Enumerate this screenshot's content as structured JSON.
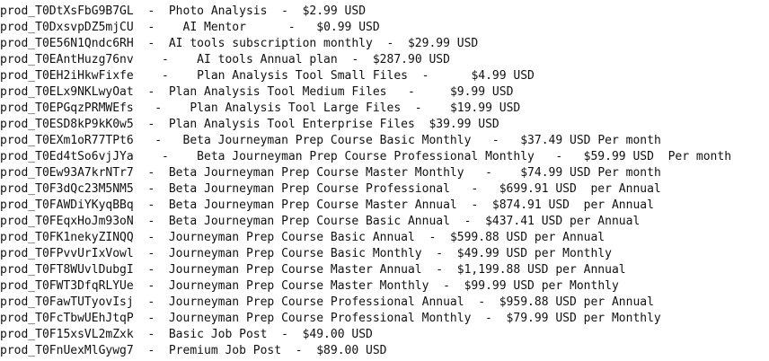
{
  "products": [
    {
      "id": "prod_T0DtXsFbG9B7GL",
      "sep1": "  -  ",
      "name": "Photo Analysis",
      "sep2": "  -  ",
      "price": "$2.99 USD",
      "period": ""
    },
    {
      "id": "prod_T0DxsvpDZ5mjCU",
      "sep1": "  -    ",
      "name": "AI Mentor",
      "sep2": "      -   ",
      "price": "$0.99 USD",
      "period": ""
    },
    {
      "id": "prod_T0E56N1Qndc6RH",
      "sep1": "  -  ",
      "name": "AI tools subscription monthly",
      "sep2": "  -  ",
      "price": "$29.99 USD",
      "period": ""
    },
    {
      "id": "prod_T0EAntHuzg76nv",
      "sep1": "    -    ",
      "name": "AI tools Annual plan",
      "sep2": "  -  ",
      "price": "$287.90 USD",
      "period": ""
    },
    {
      "id": "prod_T0EH2iHkwFixfe",
      "sep1": "    -    ",
      "name": "Plan Analysis Tool Small Files",
      "sep2": "  -      ",
      "price": "$4.99 USD",
      "period": ""
    },
    {
      "id": "prod_T0ELx9NKLwyOat",
      "sep1": "  -  ",
      "name": "Plan Analysis Tool Medium Files",
      "sep2": "   -     ",
      "price": "$9.99 USD",
      "period": ""
    },
    {
      "id": "prod_T0EPGqzPRMWEfs",
      "sep1": "   -    ",
      "name": "Plan Analysis Tool Large Files",
      "sep2": "  -    ",
      "price": "$19.99 USD",
      "period": ""
    },
    {
      "id": "prod_T0ESD8kP9kK0w5",
      "sep1": "  -  ",
      "name": "Plan Analysis Tool Enterprise Files",
      "sep2": "  ",
      "price": "$39.99 USD",
      "period": ""
    },
    {
      "id": "prod_T0EXm1oR77TPt6",
      "sep1": "   -   ",
      "name": "Beta Journeyman Prep Course Basic Monthly",
      "sep2": "   -   ",
      "price": "$37.49 USD",
      "period": " Per month"
    },
    {
      "id": "prod_T0Ed4tSo6vjJYa",
      "sep1": "    -    ",
      "name": "Beta Journeyman Prep Course Professional Monthly",
      "sep2": "   -   ",
      "price": "$59.99 USD",
      "period": "  Per month"
    },
    {
      "id": "prod_T0Ew93A7krNTr7",
      "sep1": "  -  ",
      "name": "Beta Journeyman Prep Course Master Monthly",
      "sep2": "   -    ",
      "price": "$74.99 USD",
      "period": " Per month"
    },
    {
      "id": "prod_T0F3dQc23M5NM5",
      "sep1": "  -  ",
      "name": "Beta Journeyman Prep Course Professional",
      "sep2": "   -   ",
      "price": "$699.91 USD",
      "period": "  per Annual"
    },
    {
      "id": "prod_T0FAWDiYKyqBBq",
      "sep1": "  -  ",
      "name": "Beta Journeyman Prep Course Master Annual",
      "sep2": "  -  ",
      "price": "$874.91 USD",
      "period": "  per Annual"
    },
    {
      "id": "prod_T0FEqxHoJm93oN",
      "sep1": "  -  ",
      "name": "Beta Journeyman Prep Course Basic Annual",
      "sep2": "  -  ",
      "price": "$437.41 USD",
      "period": " per Annual"
    },
    {
      "id": "prod_T0FK1nekyZINQQ",
      "sep1": "  -  ",
      "name": "Journeyman Prep Course Basic Annual",
      "sep2": "  -  ",
      "price": "$599.88 USD",
      "period": " per Annual"
    },
    {
      "id": "prod_T0FPvvUrIxVowl",
      "sep1": "  -  ",
      "name": "Journeyman Prep Course Basic Monthly",
      "sep2": "  -  ",
      "price": "$49.99 USD",
      "period": " per Monthly"
    },
    {
      "id": "prod_T0FT8WUvlDubgI",
      "sep1": "  -  ",
      "name": "Journeyman Prep Course Master Annual",
      "sep2": "  -  ",
      "price": "$1,199.88 USD",
      "period": " per Annual"
    },
    {
      "id": "prod_T0FWT3DfqRLYUe",
      "sep1": "  -  ",
      "name": "Journeyman Prep Course Master Monthly",
      "sep2": "  -  ",
      "price": "$99.99 USD",
      "period": " per Monthly"
    },
    {
      "id": "prod_T0FawTUTyovIsj",
      "sep1": "  -  ",
      "name": "Journeyman Prep Course Professional Annual",
      "sep2": "  -  ",
      "price": "$959.88 USD",
      "period": " per Annual"
    },
    {
      "id": "prod_T0FcTbwUEhJtqP",
      "sep1": "  -  ",
      "name": "Journeyman Prep Course Professional Monthly",
      "sep2": "  -  ",
      "price": "$79.99 USD",
      "period": " per Monthly"
    },
    {
      "id": "prod_T0F15xsVL2mZxk",
      "sep1": "  -  ",
      "name": "Basic Job Post",
      "sep2": "  -  ",
      "price": "$49.00 USD",
      "period": ""
    },
    {
      "id": "prod_T0FnUexMlGywg7",
      "sep1": "  -  ",
      "name": "Premium Job Post",
      "sep2": "  -  ",
      "price": "$89.00 USD",
      "period": ""
    }
  ]
}
